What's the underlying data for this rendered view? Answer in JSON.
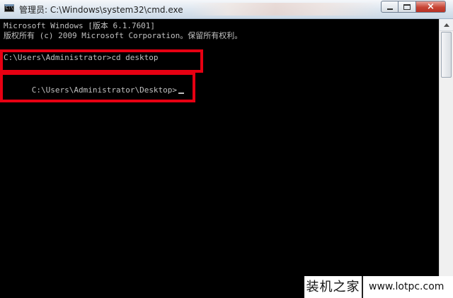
{
  "window": {
    "icon_label": "C:\\",
    "title": "管理员: C:\\Windows\\system32\\cmd.exe",
    "controls": {
      "minimize_icon": "minimize-icon",
      "maximize_icon": "maximize-icon",
      "close_icon": "close-icon",
      "close_glyph": "×"
    }
  },
  "console": {
    "lines": [
      "Microsoft Windows [版本 6.1.7601]",
      "版权所有 (c) 2009 Microsoft Corporation。保留所有权利。",
      "",
      "C:\\Users\\Administrator>cd desktop",
      "",
      "C:\\Users\\Administrator\\Desktop>"
    ]
  },
  "watermark": {
    "chinese": "装机之家",
    "url": "www.lotpc.com"
  },
  "colors": {
    "background": "#000000",
    "console_text": "#c0c0c0",
    "highlight": "#e60012",
    "titlebar": "#dbe5ef",
    "close_button": "#c74535"
  }
}
